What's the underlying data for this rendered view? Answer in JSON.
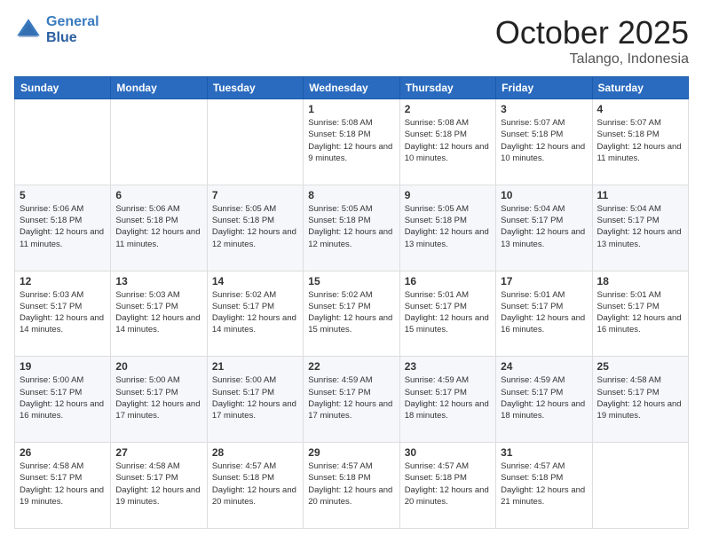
{
  "header": {
    "logo_line1": "General",
    "logo_line2": "Blue",
    "month": "October 2025",
    "location": "Talango, Indonesia"
  },
  "weekdays": [
    "Sunday",
    "Monday",
    "Tuesday",
    "Wednesday",
    "Thursday",
    "Friday",
    "Saturday"
  ],
  "weeks": [
    [
      {
        "day": "",
        "sunrise": "",
        "sunset": "",
        "daylight": ""
      },
      {
        "day": "",
        "sunrise": "",
        "sunset": "",
        "daylight": ""
      },
      {
        "day": "",
        "sunrise": "",
        "sunset": "",
        "daylight": ""
      },
      {
        "day": "1",
        "sunrise": "Sunrise: 5:08 AM",
        "sunset": "Sunset: 5:18 PM",
        "daylight": "Daylight: 12 hours and 9 minutes."
      },
      {
        "day": "2",
        "sunrise": "Sunrise: 5:08 AM",
        "sunset": "Sunset: 5:18 PM",
        "daylight": "Daylight: 12 hours and 10 minutes."
      },
      {
        "day": "3",
        "sunrise": "Sunrise: 5:07 AM",
        "sunset": "Sunset: 5:18 PM",
        "daylight": "Daylight: 12 hours and 10 minutes."
      },
      {
        "day": "4",
        "sunrise": "Sunrise: 5:07 AM",
        "sunset": "Sunset: 5:18 PM",
        "daylight": "Daylight: 12 hours and 11 minutes."
      }
    ],
    [
      {
        "day": "5",
        "sunrise": "Sunrise: 5:06 AM",
        "sunset": "Sunset: 5:18 PM",
        "daylight": "Daylight: 12 hours and 11 minutes."
      },
      {
        "day": "6",
        "sunrise": "Sunrise: 5:06 AM",
        "sunset": "Sunset: 5:18 PM",
        "daylight": "Daylight: 12 hours and 11 minutes."
      },
      {
        "day": "7",
        "sunrise": "Sunrise: 5:05 AM",
        "sunset": "Sunset: 5:18 PM",
        "daylight": "Daylight: 12 hours and 12 minutes."
      },
      {
        "day": "8",
        "sunrise": "Sunrise: 5:05 AM",
        "sunset": "Sunset: 5:18 PM",
        "daylight": "Daylight: 12 hours and 12 minutes."
      },
      {
        "day": "9",
        "sunrise": "Sunrise: 5:05 AM",
        "sunset": "Sunset: 5:18 PM",
        "daylight": "Daylight: 12 hours and 13 minutes."
      },
      {
        "day": "10",
        "sunrise": "Sunrise: 5:04 AM",
        "sunset": "Sunset: 5:17 PM",
        "daylight": "Daylight: 12 hours and 13 minutes."
      },
      {
        "day": "11",
        "sunrise": "Sunrise: 5:04 AM",
        "sunset": "Sunset: 5:17 PM",
        "daylight": "Daylight: 12 hours and 13 minutes."
      }
    ],
    [
      {
        "day": "12",
        "sunrise": "Sunrise: 5:03 AM",
        "sunset": "Sunset: 5:17 PM",
        "daylight": "Daylight: 12 hours and 14 minutes."
      },
      {
        "day": "13",
        "sunrise": "Sunrise: 5:03 AM",
        "sunset": "Sunset: 5:17 PM",
        "daylight": "Daylight: 12 hours and 14 minutes."
      },
      {
        "day": "14",
        "sunrise": "Sunrise: 5:02 AM",
        "sunset": "Sunset: 5:17 PM",
        "daylight": "Daylight: 12 hours and 14 minutes."
      },
      {
        "day": "15",
        "sunrise": "Sunrise: 5:02 AM",
        "sunset": "Sunset: 5:17 PM",
        "daylight": "Daylight: 12 hours and 15 minutes."
      },
      {
        "day": "16",
        "sunrise": "Sunrise: 5:01 AM",
        "sunset": "Sunset: 5:17 PM",
        "daylight": "Daylight: 12 hours and 15 minutes."
      },
      {
        "day": "17",
        "sunrise": "Sunrise: 5:01 AM",
        "sunset": "Sunset: 5:17 PM",
        "daylight": "Daylight: 12 hours and 16 minutes."
      },
      {
        "day": "18",
        "sunrise": "Sunrise: 5:01 AM",
        "sunset": "Sunset: 5:17 PM",
        "daylight": "Daylight: 12 hours and 16 minutes."
      }
    ],
    [
      {
        "day": "19",
        "sunrise": "Sunrise: 5:00 AM",
        "sunset": "Sunset: 5:17 PM",
        "daylight": "Daylight: 12 hours and 16 minutes."
      },
      {
        "day": "20",
        "sunrise": "Sunrise: 5:00 AM",
        "sunset": "Sunset: 5:17 PM",
        "daylight": "Daylight: 12 hours and 17 minutes."
      },
      {
        "day": "21",
        "sunrise": "Sunrise: 5:00 AM",
        "sunset": "Sunset: 5:17 PM",
        "daylight": "Daylight: 12 hours and 17 minutes."
      },
      {
        "day": "22",
        "sunrise": "Sunrise: 4:59 AM",
        "sunset": "Sunset: 5:17 PM",
        "daylight": "Daylight: 12 hours and 17 minutes."
      },
      {
        "day": "23",
        "sunrise": "Sunrise: 4:59 AM",
        "sunset": "Sunset: 5:17 PM",
        "daylight": "Daylight: 12 hours and 18 minutes."
      },
      {
        "day": "24",
        "sunrise": "Sunrise: 4:59 AM",
        "sunset": "Sunset: 5:17 PM",
        "daylight": "Daylight: 12 hours and 18 minutes."
      },
      {
        "day": "25",
        "sunrise": "Sunrise: 4:58 AM",
        "sunset": "Sunset: 5:17 PM",
        "daylight": "Daylight: 12 hours and 19 minutes."
      }
    ],
    [
      {
        "day": "26",
        "sunrise": "Sunrise: 4:58 AM",
        "sunset": "Sunset: 5:17 PM",
        "daylight": "Daylight: 12 hours and 19 minutes."
      },
      {
        "day": "27",
        "sunrise": "Sunrise: 4:58 AM",
        "sunset": "Sunset: 5:17 PM",
        "daylight": "Daylight: 12 hours and 19 minutes."
      },
      {
        "day": "28",
        "sunrise": "Sunrise: 4:57 AM",
        "sunset": "Sunset: 5:18 PM",
        "daylight": "Daylight: 12 hours and 20 minutes."
      },
      {
        "day": "29",
        "sunrise": "Sunrise: 4:57 AM",
        "sunset": "Sunset: 5:18 PM",
        "daylight": "Daylight: 12 hours and 20 minutes."
      },
      {
        "day": "30",
        "sunrise": "Sunrise: 4:57 AM",
        "sunset": "Sunset: 5:18 PM",
        "daylight": "Daylight: 12 hours and 20 minutes."
      },
      {
        "day": "31",
        "sunrise": "Sunrise: 4:57 AM",
        "sunset": "Sunset: 5:18 PM",
        "daylight": "Daylight: 12 hours and 21 minutes."
      },
      {
        "day": "",
        "sunrise": "",
        "sunset": "",
        "daylight": ""
      }
    ]
  ]
}
